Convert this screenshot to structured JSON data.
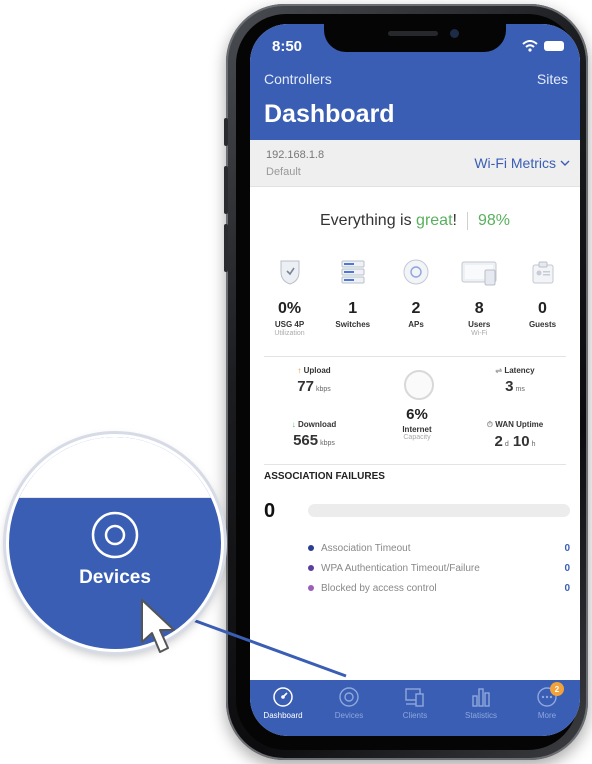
{
  "status": {
    "time": "8:50",
    "icons": [
      "wifi-icon",
      "battery-icon"
    ]
  },
  "nav": {
    "controllers": "Controllers",
    "sites": "Sites"
  },
  "page": {
    "title": "Dashboard"
  },
  "site": {
    "ip": "192.168.1.8",
    "name": "Default",
    "metrics_selector": "Wi-Fi Metrics"
  },
  "health": {
    "prefix": "Everything is ",
    "word": "great",
    "suffix": "!",
    "percent": "98%"
  },
  "devices": [
    {
      "icon": "gateway-icon",
      "value": "0%",
      "label": "USG 4P",
      "sub": "Utilization"
    },
    {
      "icon": "switch-icon",
      "value": "1",
      "label": "Switches",
      "sub": ""
    },
    {
      "icon": "access-point-icon",
      "value": "2",
      "label": "APs",
      "sub": ""
    },
    {
      "icon": "users-icon",
      "value": "8",
      "label": "Users",
      "sub": "Wi-Fi"
    },
    {
      "icon": "guest-badge-icon",
      "value": "0",
      "label": "Guests",
      "sub": ""
    }
  ],
  "throughput": {
    "upload_label": "Upload",
    "upload_value": "77",
    "upload_unit": "kbps",
    "download_label": "Download",
    "download_value": "565",
    "download_unit": "kbps",
    "latency_label": "Latency",
    "latency_value": "3",
    "latency_unit": "ms",
    "uptime_label": "WAN Uptime",
    "uptime_days": "2",
    "uptime_days_unit": "d",
    "uptime_hours": "10",
    "uptime_hours_unit": "h"
  },
  "internet": {
    "percent": "6%",
    "label": "Internet",
    "sub": "Capacity"
  },
  "association": {
    "heading": "ASSOCIATION FAILURES",
    "total": "0",
    "items": [
      {
        "label": "Association Timeout",
        "count": "0",
        "color": "#2c3f8f"
      },
      {
        "label": "WPA Authentication Timeout/Failure",
        "count": "0",
        "color": "#5a3f9e"
      },
      {
        "label": "Blocked by access control",
        "count": "0",
        "color": "#9a5fb8"
      }
    ]
  },
  "tabs": [
    {
      "label": "Dashboard",
      "icon": "dashboard-icon",
      "active": true
    },
    {
      "label": "Devices",
      "icon": "devices-icon",
      "active": false
    },
    {
      "label": "Clients",
      "icon": "clients-icon",
      "active": false
    },
    {
      "label": "Statistics",
      "icon": "statistics-icon",
      "active": false
    },
    {
      "label": "More",
      "icon": "more-icon",
      "active": false,
      "badge": "2"
    }
  ],
  "callout": {
    "label": "Devices",
    "icon": "devices-icon"
  },
  "colors": {
    "brand_blue": "#3a5eb4",
    "good_green": "#58b05c",
    "badge_orange": "#f2a23a"
  }
}
